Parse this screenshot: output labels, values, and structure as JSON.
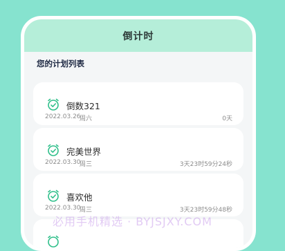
{
  "header": {
    "title": "倒计时"
  },
  "section": {
    "title": "您的计划列表"
  },
  "plans": [
    {
      "name": "倒数321",
      "date": "2022.03.26",
      "weekday": "周六",
      "remaining": "0天"
    },
    {
      "name": "完美世界",
      "date": "2022.03.30",
      "weekday": "周三",
      "remaining": "3天23时59分24秒"
    },
    {
      "name": "喜欢他",
      "date": "2022.03.30",
      "weekday": "周三",
      "remaining": "3天23时59分48秒"
    }
  ],
  "watermark": {
    "text": "必用手机精选 · BYJSJXY.COM"
  },
  "colors": {
    "background": "#86e3cf",
    "header": "#b5eed9",
    "icon": "#2fbf8a"
  }
}
